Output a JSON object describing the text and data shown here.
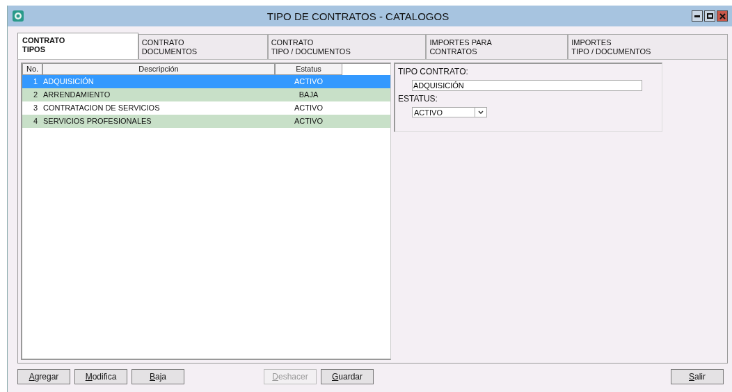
{
  "window": {
    "title": "TIPO DE CONTRATOS - CATALOGOS"
  },
  "tabs": [
    {
      "lines": [
        "CONTRATO",
        "TIPOS"
      ],
      "selected": true
    },
    {
      "lines": [
        "CONTRATO",
        "DOCUMENTOS"
      ],
      "selected": false
    },
    {
      "lines": [
        "CONTRATO",
        "TIPO / DOCUMENTOS"
      ],
      "selected": false
    },
    {
      "lines": [
        "IMPORTES PARA",
        "CONTRATOS"
      ],
      "selected": false
    },
    {
      "lines": [
        "IMPORTES",
        "TIPO / DOCUMENTOS"
      ],
      "selected": false
    }
  ],
  "table": {
    "columns": [
      "No.",
      "Descripción",
      "Estatus"
    ],
    "rows": [
      {
        "no": "1",
        "descripcion": "ADQUISICIÓN",
        "estatus": "ACTIVO",
        "selected": true
      },
      {
        "no": "2",
        "descripcion": "ARRENDAMIENTO",
        "estatus": "BAJA",
        "selected": false
      },
      {
        "no": "3",
        "descripcion": "CONTRATACION DE SERVICIOS",
        "estatus": "ACTIVO",
        "selected": false
      },
      {
        "no": "4",
        "descripcion": "SERVICIOS PROFESIONALES",
        "estatus": "ACTIVO",
        "selected": false
      }
    ]
  },
  "form": {
    "tipo_label": "TIPO CONTRATO:",
    "tipo_value": "ADQUISICIÓN",
    "estatus_label": "ESTATUS:",
    "estatus_value": "ACTIVO"
  },
  "buttons": {
    "left": [
      {
        "label": "Agregar",
        "disabled": false
      },
      {
        "label": "Modifica",
        "disabled": false
      },
      {
        "label": "Baja",
        "disabled": false
      }
    ],
    "middle": [
      {
        "label": "Deshacer",
        "disabled": true
      },
      {
        "label": "Guardar",
        "disabled": false
      }
    ],
    "right": [
      {
        "label": "Salir",
        "disabled": false
      }
    ]
  }
}
